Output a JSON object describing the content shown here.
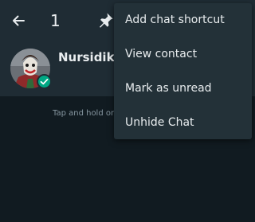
{
  "appbar": {
    "selected_count": "1",
    "back_icon": "arrow-left-icon",
    "pin_icon": "pin-icon"
  },
  "chat": {
    "name": "Nursidik",
    "avatar_icon": "clown-avatar",
    "badge_icon": "check-icon"
  },
  "hint": {
    "text": "Tap and hold on"
  },
  "menu": {
    "items": [
      {
        "label": "Add chat shortcut"
      },
      {
        "label": "View contact"
      },
      {
        "label": "Mark as unread"
      },
      {
        "label": "Unhide Chat"
      }
    ]
  },
  "colors": {
    "background": "#111b21",
    "appbar": "#1f2c34",
    "menu": "#233138",
    "accent": "#00a884",
    "secondary_text": "#8696a0"
  }
}
